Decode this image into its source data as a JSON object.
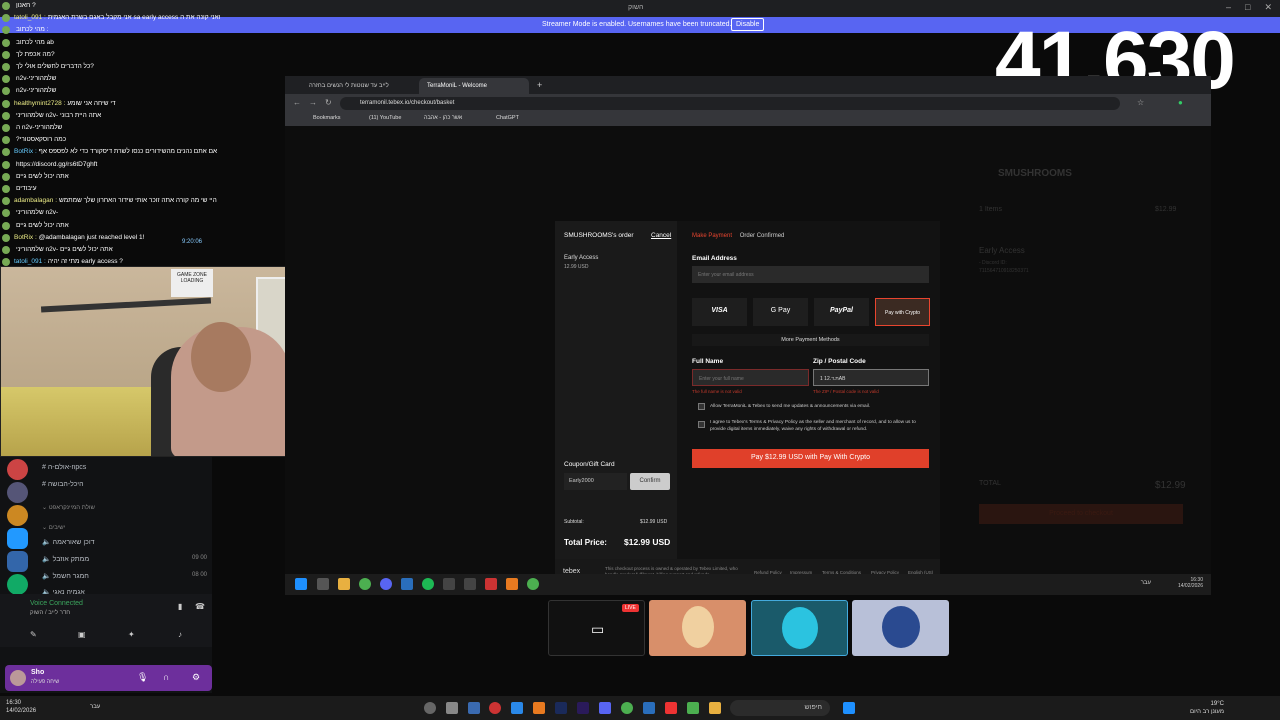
{
  "titlebar": {
    "title": "השוק"
  },
  "banner": {
    "message": "Streamer Mode is enabled. Usernames have been truncated.",
    "disable_label": "Disable"
  },
  "overlay": {
    "counter": "41,630"
  },
  "chat": {
    "lines": [
      {
        "name": "",
        "text": "חאנון ?"
      },
      {
        "name": "tatoli_091 :",
        "text": "אני מקבל באגם בשרת האגמית sa early access ואני קונה את ה"
      },
      {
        "name": "",
        "text": "מהי לכתוב :"
      },
      {
        "name": "",
        "text": "מהי לכתוב ab"
      },
      {
        "name": "",
        "text": "מה אכפת לך?"
      },
      {
        "name": "",
        "text": "כל הדברים לחשלים אולי לך?"
      },
      {
        "name": "",
        "text": "n2v-שלמהוריני"
      },
      {
        "name": "",
        "text": "n2v-שלמהוריני"
      },
      {
        "name": "healthymint2728 :",
        "text": "די שיחה אני שומע"
      },
      {
        "name": "",
        "text": "שלמהוריני n2v- אתה היית רבוני"
      },
      {
        "name": "",
        "text": "ה n2v-שלמהוריני"
      },
      {
        "name": "",
        "text": "?כמה רוסקאסטורי"
      },
      {
        "name": "BotRix :",
        "text": "אם אתם נהנים מהשידורים כנסו לשרת דיסקורד כדי לא לפספס אף"
      },
      {
        "name": "",
        "text": "https://discord.gg/rs6tD7ghft"
      },
      {
        "name": "",
        "text": "אתה יכול לשים גיים"
      },
      {
        "name": "",
        "text": "עיבודים"
      },
      {
        "name": "adambalagan :",
        "text": "היי שי מה קורה אתה זוכר אותי שידור האחרון שלך שמתמש"
      },
      {
        "name": "",
        "text": "שלמהוריני n2v-"
      },
      {
        "name": "",
        "text": "אתה יכול לשים גיים"
      },
      {
        "name": "BotRix :",
        "text": "@adambalagan just reached level 1!"
      },
      {
        "name": "",
        "text": "שלמהוריני n2v- אתה יכול לשים גיים"
      },
      {
        "name": "tatoli_091 :",
        "text": "מתי זה יהיה early access ?"
      }
    ],
    "time": "9:20:06"
  },
  "webcam": {
    "sign_text": "GAME ZONE LOADING"
  },
  "discord": {
    "channels": [
      {
        "label": "אולם-ה-npcs",
        "right": ""
      },
      {
        "label": "היכל-הבושה",
        "right": ""
      },
      {
        "label": "שולת המיינקראפט",
        "right": ""
      },
      {
        "label": "ישיבים",
        "right": ""
      },
      {
        "label": "דוכן שאוראמה",
        "right": ""
      },
      {
        "label": "ממתק אוזבל",
        "right": "09 00"
      },
      {
        "label": "חמגר חשמל",
        "right": "08 00"
      },
      {
        "label": "אגמיה נאגי",
        "right": ""
      }
    ],
    "voice_status": "Voice Connected",
    "voice_channel": "חדר לייב / השוק",
    "user_name": "Sho",
    "user_status": "שיחה פעילה"
  },
  "browser": {
    "tabs": [
      {
        "label": "לייב עד שנוטות לי הנשים בחזרה"
      },
      {
        "label": "TerraMoniL - Welcome"
      }
    ],
    "url": "terramonil.tebex.io/checkout/basket",
    "bookmarks": [
      "Bookmarks",
      "(11) YouTube",
      "אשר כהן - אהבה",
      "ChatGPT"
    ]
  },
  "bg_store": {
    "title": "SMUSHROOMS",
    "items_count": "1 Items",
    "price_top": "$12.99",
    "item_name": "Early Access",
    "discord_id": "- Discord ID:",
    "discord_id_val": "711564710918250371",
    "total_label": "TOTAL",
    "total_val": "$12.99",
    "proceed": "Proceed to checkout"
  },
  "checkout": {
    "order_title": "SMUSHROOMS's order",
    "cancel": "Cancel",
    "item_name": "Early Access",
    "item_price": "12.99 USD",
    "breadcrumb_active": "Make Payment",
    "breadcrumb_next": "Order Confirmed",
    "email_label": "Email Address",
    "email_placeholder": "Enter your email address",
    "payment_methods": [
      "VISA",
      "G Pay",
      "PayPal",
      "Pay with Crypto"
    ],
    "more_methods": "More Payment Methods",
    "fullname_label": "Full Name",
    "fullname_placeholder": "Enter your full name",
    "fullname_error": "The full name is not valid",
    "zip_label": "Zip / Postal Code",
    "zip_value": "ת.ד.12 1AB",
    "zip_error": "The ZIP / Postal code is not valid",
    "check1": "Allow TerraMoniL & Tebex to send me updates & announcements via email.",
    "check2": "I agree to Tebex's Terms & Privacy Policy as the seller and merchant of record, and to allow us to provide digital items immediately, waive any rights of withdrawal or refund.",
    "pay_button": "Pay $12.99 USD with Pay With Crypto",
    "coupon_label": "Coupon/Gift Card",
    "coupon_value": "Early2000",
    "confirm": "Confirm",
    "subtotal_label": "Subtotal:",
    "subtotal_val": "$12.99 USD",
    "total_label": "Total Price:",
    "total_val": "$12.99 USD",
    "footer_brand": "tebex",
    "footer_text": "This checkout process is owned & operated by Tebex Limited, who handle product fulfilment, billing support and refunds.",
    "footer_links": [
      "Refund Policy",
      "Impressum",
      "Terms & Conditions",
      "Privacy Policy",
      "English (US)"
    ]
  },
  "inner_taskbar": {
    "lang": "עבר",
    "time": "16:30",
    "date": "14/02/2026"
  },
  "system_taskbar": {
    "search": "חיפוש",
    "time": "16:30",
    "date": "14/02/2026",
    "weather": "19°C",
    "weather_sub": "מעונן רב היום",
    "lang": "עבר"
  },
  "stream": {
    "live": "LIVE"
  }
}
